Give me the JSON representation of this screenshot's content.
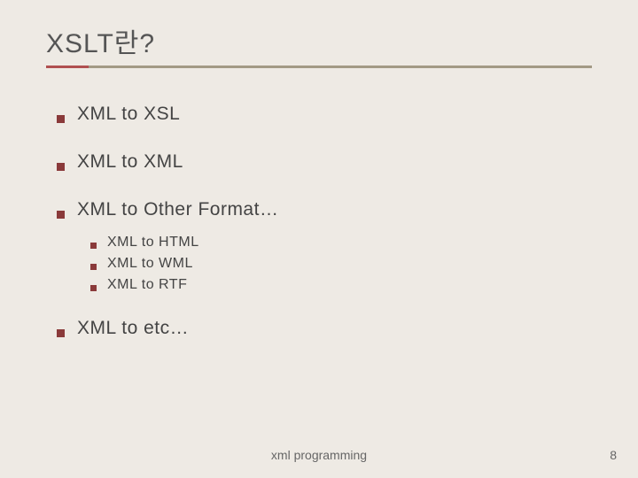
{
  "title": "XSLT란?",
  "bullets": {
    "b1": "XML to XSL",
    "b2": "XML to XML",
    "b3": "XML to Other Format…",
    "b4": "XML to etc…"
  },
  "sub": {
    "s1": "XML to HTML",
    "s2": "XML to WML",
    "s3": "XML to RTF"
  },
  "footer": {
    "center": "xml programming",
    "page": "8"
  }
}
